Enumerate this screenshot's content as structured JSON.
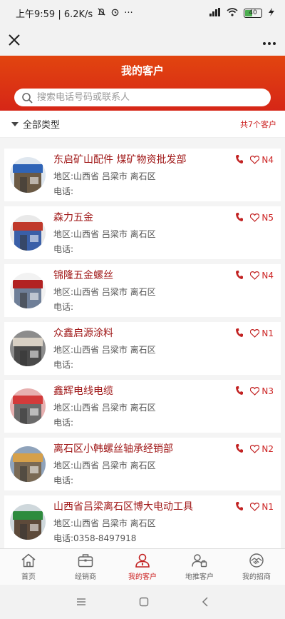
{
  "status": {
    "time": "上午9:59 | 6.2K/s",
    "battery": "40"
  },
  "header": {
    "title": "我的客户",
    "search_placeholder": "搜索电话号码或联系人"
  },
  "filter": {
    "category": "全部类型",
    "count": "共7个客户"
  },
  "customers": [
    {
      "name": "东启矿山配件 煤矿物资批发部",
      "region": "地区:山西省 吕梁市 离石区",
      "phone": "电话:",
      "level": "N4",
      "avatar_colors": [
        "#2f64b7",
        "#dfe7ef",
        "#6b5a45"
      ]
    },
    {
      "name": "森力五金",
      "region": "地区:山西省 吕梁市 离石区",
      "phone": "电话:",
      "level": "N5",
      "avatar_colors": [
        "#c0392b",
        "#e9e9e9",
        "#3a5fa8"
      ]
    },
    {
      "name": "锦隆五金螺丝",
      "region": "地区:山西省 吕梁市 离石区",
      "phone": "电话:",
      "level": "N4",
      "avatar_colors": [
        "#b22222",
        "#f2f2f2",
        "#6f7f98"
      ]
    },
    {
      "name": "众鑫启源涂料",
      "region": "地区:山西省 吕梁市 离石区",
      "phone": "电话:",
      "level": "N1",
      "avatar_colors": [
        "#d8d0c4",
        "#8c8c8c",
        "#4a4a4a"
      ]
    },
    {
      "name": "鑫辉电线电缆",
      "region": "地区:山西省 吕梁市 离石区",
      "phone": "电话:",
      "level": "N3",
      "avatar_colors": [
        "#d33b3b",
        "#e7b0b0",
        "#6b6b6b"
      ]
    },
    {
      "name": "离石区小韩螺丝轴承经销部",
      "region": "地区:山西省 吕梁市 离石区",
      "phone": "电话:",
      "level": "N2",
      "avatar_colors": [
        "#d6a04a",
        "#8fa3bb",
        "#7a6a55"
      ]
    },
    {
      "name": "山西省吕梁离石区博大电动工具",
      "region": "地区:山西省 吕梁市 离石区",
      "phone": "电话:0358-8497918",
      "level": "N1",
      "avatar_colors": [
        "#2e8b3e",
        "#cfd8dc",
        "#5d4a3a"
      ]
    }
  ],
  "tabs": [
    {
      "label": "首页",
      "icon": "home-icon"
    },
    {
      "label": "经销商",
      "icon": "briefcase-icon"
    },
    {
      "label": "我的客户",
      "icon": "person-icon"
    },
    {
      "label": "地推客户",
      "icon": "promoter-icon"
    },
    {
      "label": "我的招商",
      "icon": "handshake-icon"
    }
  ],
  "colors": {
    "accent": "#c22222",
    "header_top": "#e2450f",
    "header_bottom": "#d62617"
  }
}
